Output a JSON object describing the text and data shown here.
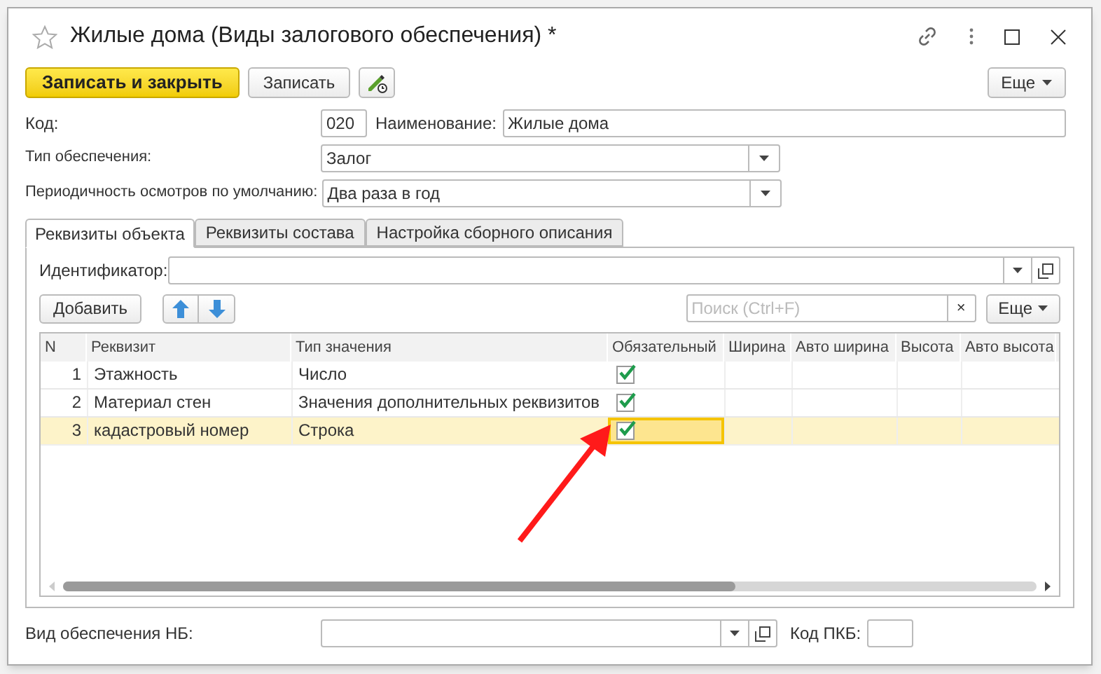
{
  "window": {
    "title": "Жилые дома (Виды залогового обеспечения) *"
  },
  "toolbar": {
    "buttons": [
      {
        "kind": "primary",
        "label": "Записать и закрыть"
      },
      {
        "kind": "default",
        "label": "Записать"
      },
      {
        "kind": "icon"
      }
    ],
    "more": "Еще"
  },
  "code": {
    "label": "Код:",
    "value": "020"
  },
  "name": {
    "label": "Наименование:",
    "value": "Жилые дома"
  },
  "fields": [
    {
      "label": "Тип обеспечения:",
      "value": "Залог"
    },
    {
      "label": "Периодичность осмотров по умолчанию:",
      "value": "Два раза в год"
    }
  ],
  "tabs": [
    {
      "label": "Реквизиты объекта",
      "selected": true
    },
    {
      "label": "Реквизиты состава",
      "selected": false
    },
    {
      "label": "Настройка сборного описания",
      "selected": false
    }
  ],
  "identifier": {
    "label": "Идентификатор:"
  },
  "list_toolbar": {
    "add": "Добавить",
    "search": {
      "placeholder": "Поиск (Ctrl+F)"
    },
    "clear": "×",
    "more": "Еще"
  },
  "table": {
    "columns": [
      "N",
      "Реквизит",
      "Тип значения",
      "Обязательный",
      "Ширина",
      "Авто ширина",
      "Высота",
      "Авто высота"
    ],
    "rows": [
      {
        "n": "1",
        "name": "Этажность",
        "type": "Число",
        "required": true,
        "selected": false
      },
      {
        "n": "2",
        "name": "Материал стен",
        "type": "Значения дополнительных реквизитов",
        "required": true,
        "selected": false
      },
      {
        "n": "3",
        "name": "кадастровый номер",
        "type": "Строка",
        "required": true,
        "selected": true
      }
    ]
  },
  "bottom": {
    "label": "Вид обеспечения НБ:",
    "code_label": "Код ПКБ:"
  }
}
